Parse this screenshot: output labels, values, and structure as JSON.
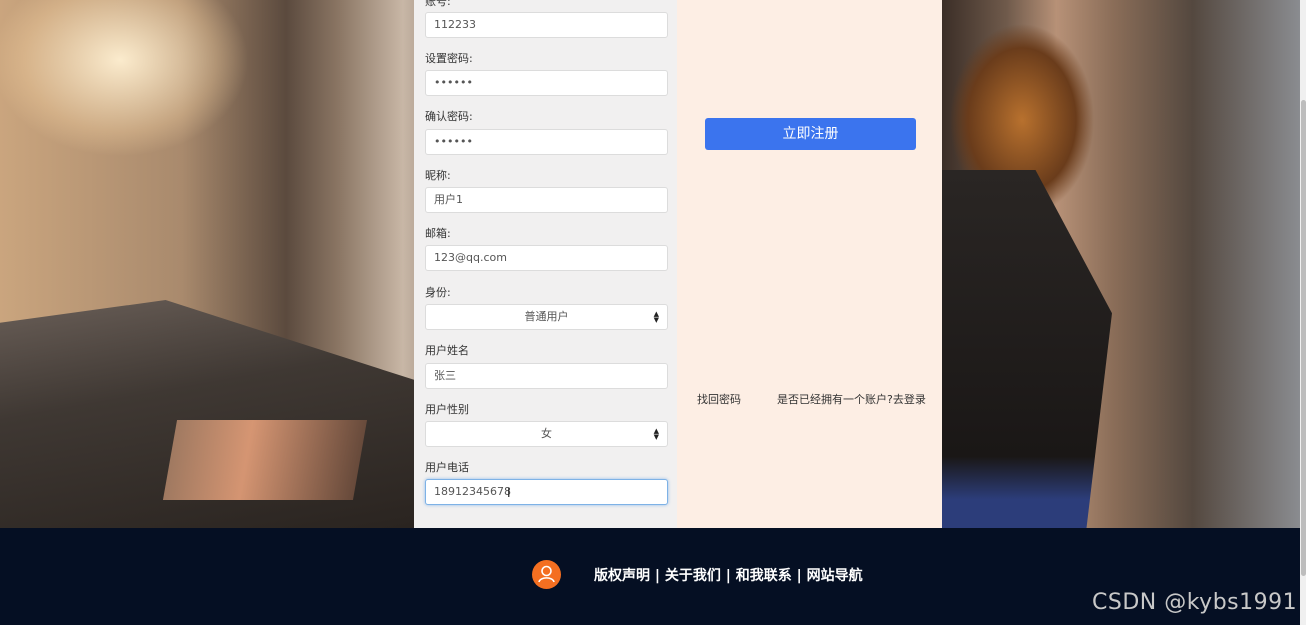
{
  "form": {
    "account_label": "账号:",
    "account_value": "112233",
    "password_label": "设置密码:",
    "password_value": "••••••",
    "confirm_label": "确认密码:",
    "confirm_value": "••••••",
    "nickname_label": "昵称:",
    "nickname_value": "用户1",
    "email_label": "邮箱:",
    "email_value": "123@qq.com",
    "role_label": "身份:",
    "role_value": "普通用户",
    "realname_label": "用户姓名",
    "realname_value": "张三",
    "gender_label": "用户性别",
    "gender_value": "女",
    "phone_label": "用户电话",
    "phone_value": "18912345678"
  },
  "side": {
    "register_button": "立即注册",
    "forgot_link": "找回密码",
    "login_link": "是否已经拥有一个账户?去登录"
  },
  "footer": {
    "links": "版权声明 | 关于我们 | 和我联系 | 网站导航",
    "watermark": "CSDN @kybs1991"
  },
  "colors": {
    "accent": "#3b74ee",
    "footer_bg": "#050f23",
    "footer_icon": "#f46f21"
  }
}
